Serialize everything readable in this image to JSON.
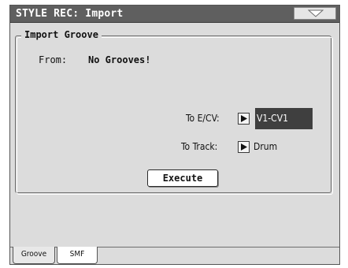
{
  "window": {
    "title": "STYLE REC: Import",
    "menu_icon": "triangle-down-icon"
  },
  "import_groove": {
    "group_title": "Import Groove",
    "from_label": "From:",
    "from_value": "No Grooves!",
    "to_ecv_label": "To E/CV:",
    "to_ecv_value": "V1-CV1",
    "to_track_label": "To Track:",
    "to_track_value": "Drum",
    "execute_label": "Execute"
  },
  "tabs": [
    {
      "label": "Groove",
      "active": true
    },
    {
      "label": "SMF",
      "active": false
    }
  ],
  "colors": {
    "titlebar": "#5f5f5f",
    "panel": "#dcdcdc",
    "selected_field": "#3f3f3f"
  }
}
